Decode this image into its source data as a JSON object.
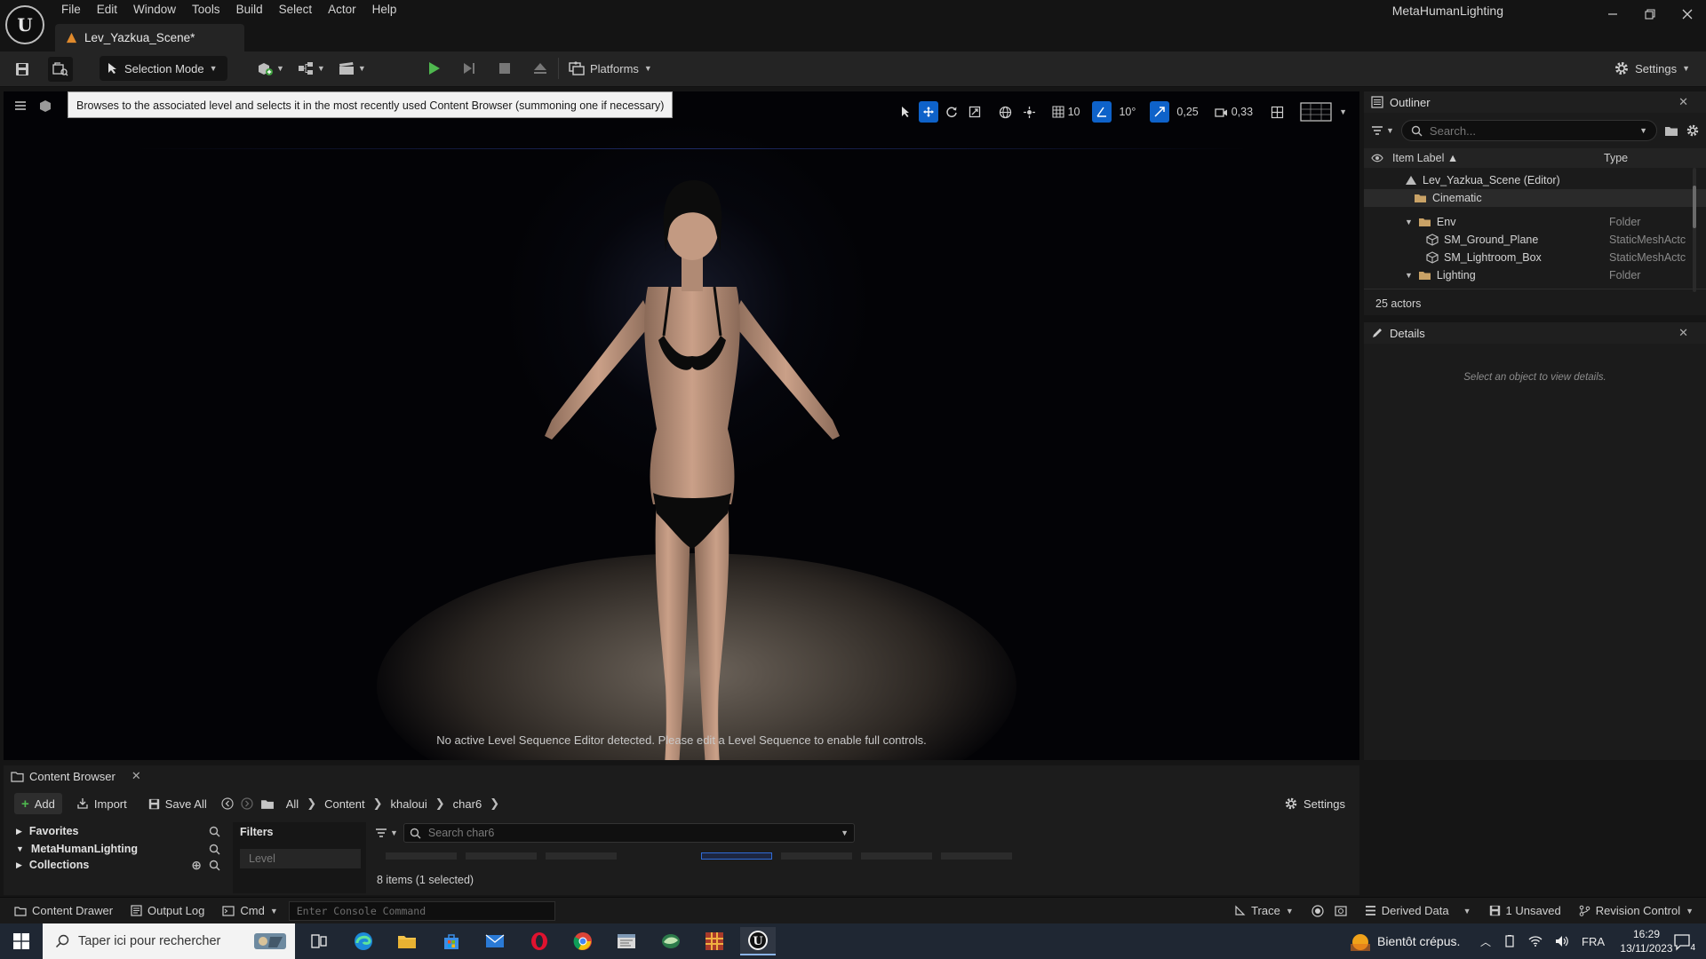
{
  "app": {
    "project_name": "MetaHumanLighting",
    "level_tab": "Lev_Yazkua_Scene*"
  },
  "menu": [
    "File",
    "Edit",
    "Window",
    "Tools",
    "Build",
    "Select",
    "Actor",
    "Help"
  ],
  "toolbar": {
    "selection_mode": "Selection Mode",
    "platforms": "Platforms",
    "settings": "Settings"
  },
  "viewport": {
    "tooltip": "Browses to the associated level and selects it in the most recently used Content Browser (summoning one if necessary)",
    "grid_snap": "10",
    "rotation_snap": "10°",
    "scale_snap": "0,25",
    "camera_speed": "0,33",
    "message": "No active Level Sequence Editor detected. Please edit a Level Sequence to enable full controls."
  },
  "outliner": {
    "title": "Outliner",
    "search_placeholder": "Search...",
    "col_label": "Item Label ▲",
    "col_type": "Type",
    "rows": [
      {
        "label": "Lev_Yazkua_Scene (Editor)",
        "type": ""
      },
      {
        "label": "Cinematic",
        "type": ""
      },
      {
        "label": "Env",
        "type": "Folder"
      },
      {
        "label": "SM_Ground_Plane",
        "type": "StaticMeshActc"
      },
      {
        "label": "SM_Lightroom_Box",
        "type": "StaticMeshActc"
      },
      {
        "label": "Lighting",
        "type": "Folder"
      }
    ],
    "count": "25 actors"
  },
  "details": {
    "title": "Details",
    "empty_text": "Select an object to view details."
  },
  "content_browser": {
    "title": "Content Browser",
    "add": "Add",
    "import": "Import",
    "save_all": "Save All",
    "breadcrumbs": [
      "All",
      "Content",
      "khaloui",
      "char6"
    ],
    "settings": "Settings",
    "favorites": "Favorites",
    "project": "MetaHumanLighting",
    "collections": "Collections",
    "filters": "Filters",
    "level_filter": "Level",
    "search_placeholder": "Search char6",
    "items_count": "8 items (1 selected)"
  },
  "statusbar": {
    "content_drawer": "Content Drawer",
    "output_log": "Output Log",
    "cmd": "Cmd",
    "console_placeholder": "Enter Console Command",
    "trace": "Trace",
    "derived_data": "Derived Data",
    "unsaved": "1 Unsaved",
    "revision_control": "Revision Control"
  },
  "taskbar": {
    "search_placeholder": "Taper ici pour rechercher",
    "weather": "Bientôt crépus.",
    "language": "FRA",
    "time": "16:29",
    "date": "13/11/2023",
    "notifications": "4"
  },
  "colors": {
    "accent": "#0e62c9",
    "panel_bg": "#1b1b1b",
    "viewport_bg": "#030306",
    "taskbar_bg": "#1f2733"
  }
}
